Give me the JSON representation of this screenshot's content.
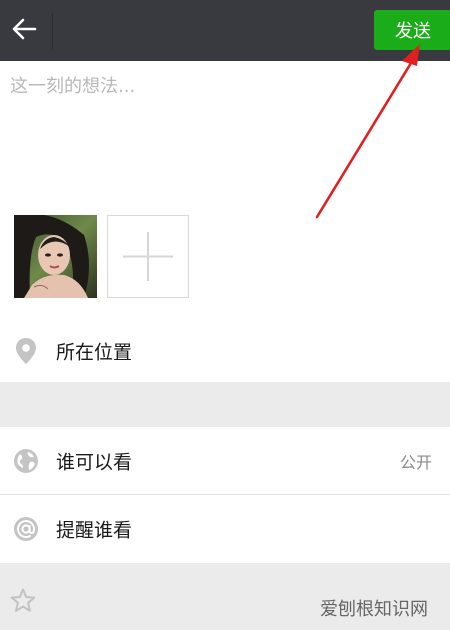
{
  "header": {
    "send_label": "发送"
  },
  "compose": {
    "placeholder": "这一刻的想法..."
  },
  "rows": {
    "location": {
      "label": "所在位置"
    },
    "visibility": {
      "label": "谁可以看",
      "value": "公开"
    },
    "remind": {
      "label": "提醒谁看"
    }
  },
  "watermark": "爱刨根知识网",
  "colors": {
    "topbar": "#393a3f",
    "send_button": "#1aad19",
    "section_gap": "#ebebeb",
    "annotation_arrow": "#e02020"
  },
  "icons": {
    "back": "arrow-left-icon",
    "location": "location-pin-icon",
    "visibility": "globe-icon",
    "remind": "at-sign-icon",
    "partial": "star-icon",
    "add_photo": "plus-icon"
  }
}
